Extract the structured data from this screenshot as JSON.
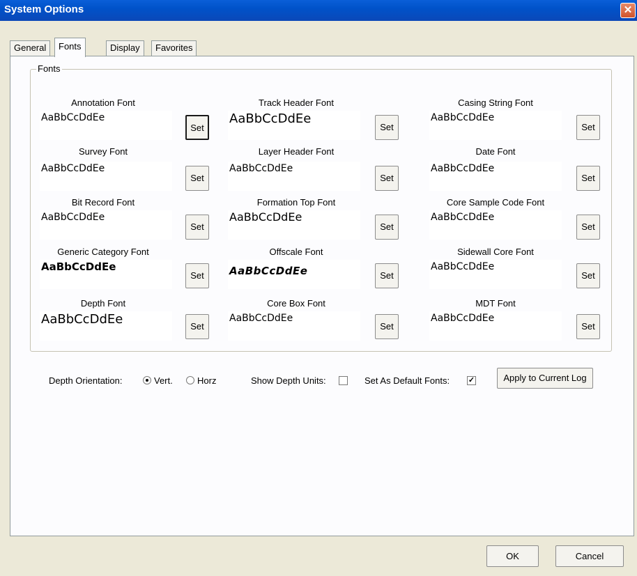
{
  "window": {
    "title": "System Options",
    "close_glyph": "✕"
  },
  "tabs": [
    {
      "label": "General",
      "active": false
    },
    {
      "label": "Fonts",
      "active": true
    },
    {
      "label": "Display",
      "active": false
    },
    {
      "label": "Favorites",
      "active": false
    }
  ],
  "fonts_group": {
    "label": "Fonts",
    "set_label": "Set",
    "sample_text": "AaBbCcDdEe",
    "fields": [
      {
        "label": "Annotation Font",
        "sample": "AaBbCcDdEe"
      },
      {
        "label": "Track Header Font",
        "sample": "AaBbCcDdEe"
      },
      {
        "label": "Casing String Font",
        "sample": "AaBbCcDdEe"
      },
      {
        "label": "Survey Font",
        "sample": "AaBbCcDdEe"
      },
      {
        "label": "Layer Header Font",
        "sample": "AaBbCcDdEe"
      },
      {
        "label": "Date Font",
        "sample": "AaBbCcDdEe"
      },
      {
        "label": "Bit Record Font",
        "sample": "AaBbCcDdEe"
      },
      {
        "label": "Formation Top Font",
        "sample": "AaBbCcDdEe"
      },
      {
        "label": "Core Sample Code Font",
        "sample": "AaBbCcDdEe"
      },
      {
        "label": "Generic Category Font",
        "sample": "AaBbCcDdEe"
      },
      {
        "label": "Offscale Font",
        "sample": "AaBbCcDdEe"
      },
      {
        "label": "Sidewall Core Font",
        "sample": "AaBbCcDdEe"
      },
      {
        "label": "Depth Font",
        "sample": "AaBbCcDdEe"
      },
      {
        "label": "Core Box Font",
        "sample": "AaBbCcDdEe"
      },
      {
        "label": "MDT Font",
        "sample": "AaBbCcDdEe"
      }
    ]
  },
  "options": {
    "depth_orientation_label": "Depth Orientation:",
    "vert_label": "Vert.",
    "horz_label": "Horz",
    "selected_orientation": "Vert.",
    "show_depth_units_label": "Show Depth Units:",
    "show_depth_units_checked": false,
    "set_default_label": "Set As Default Fonts:",
    "set_default_checked": true,
    "check_glyph": "✓",
    "apply_label": "Apply to Current Log"
  },
  "footer": {
    "ok_label": "OK",
    "cancel_label": "Cancel"
  },
  "colors": {
    "titlebar": "#0a5fd8",
    "face": "#ece9d8",
    "panel": "#fcfcfe"
  }
}
